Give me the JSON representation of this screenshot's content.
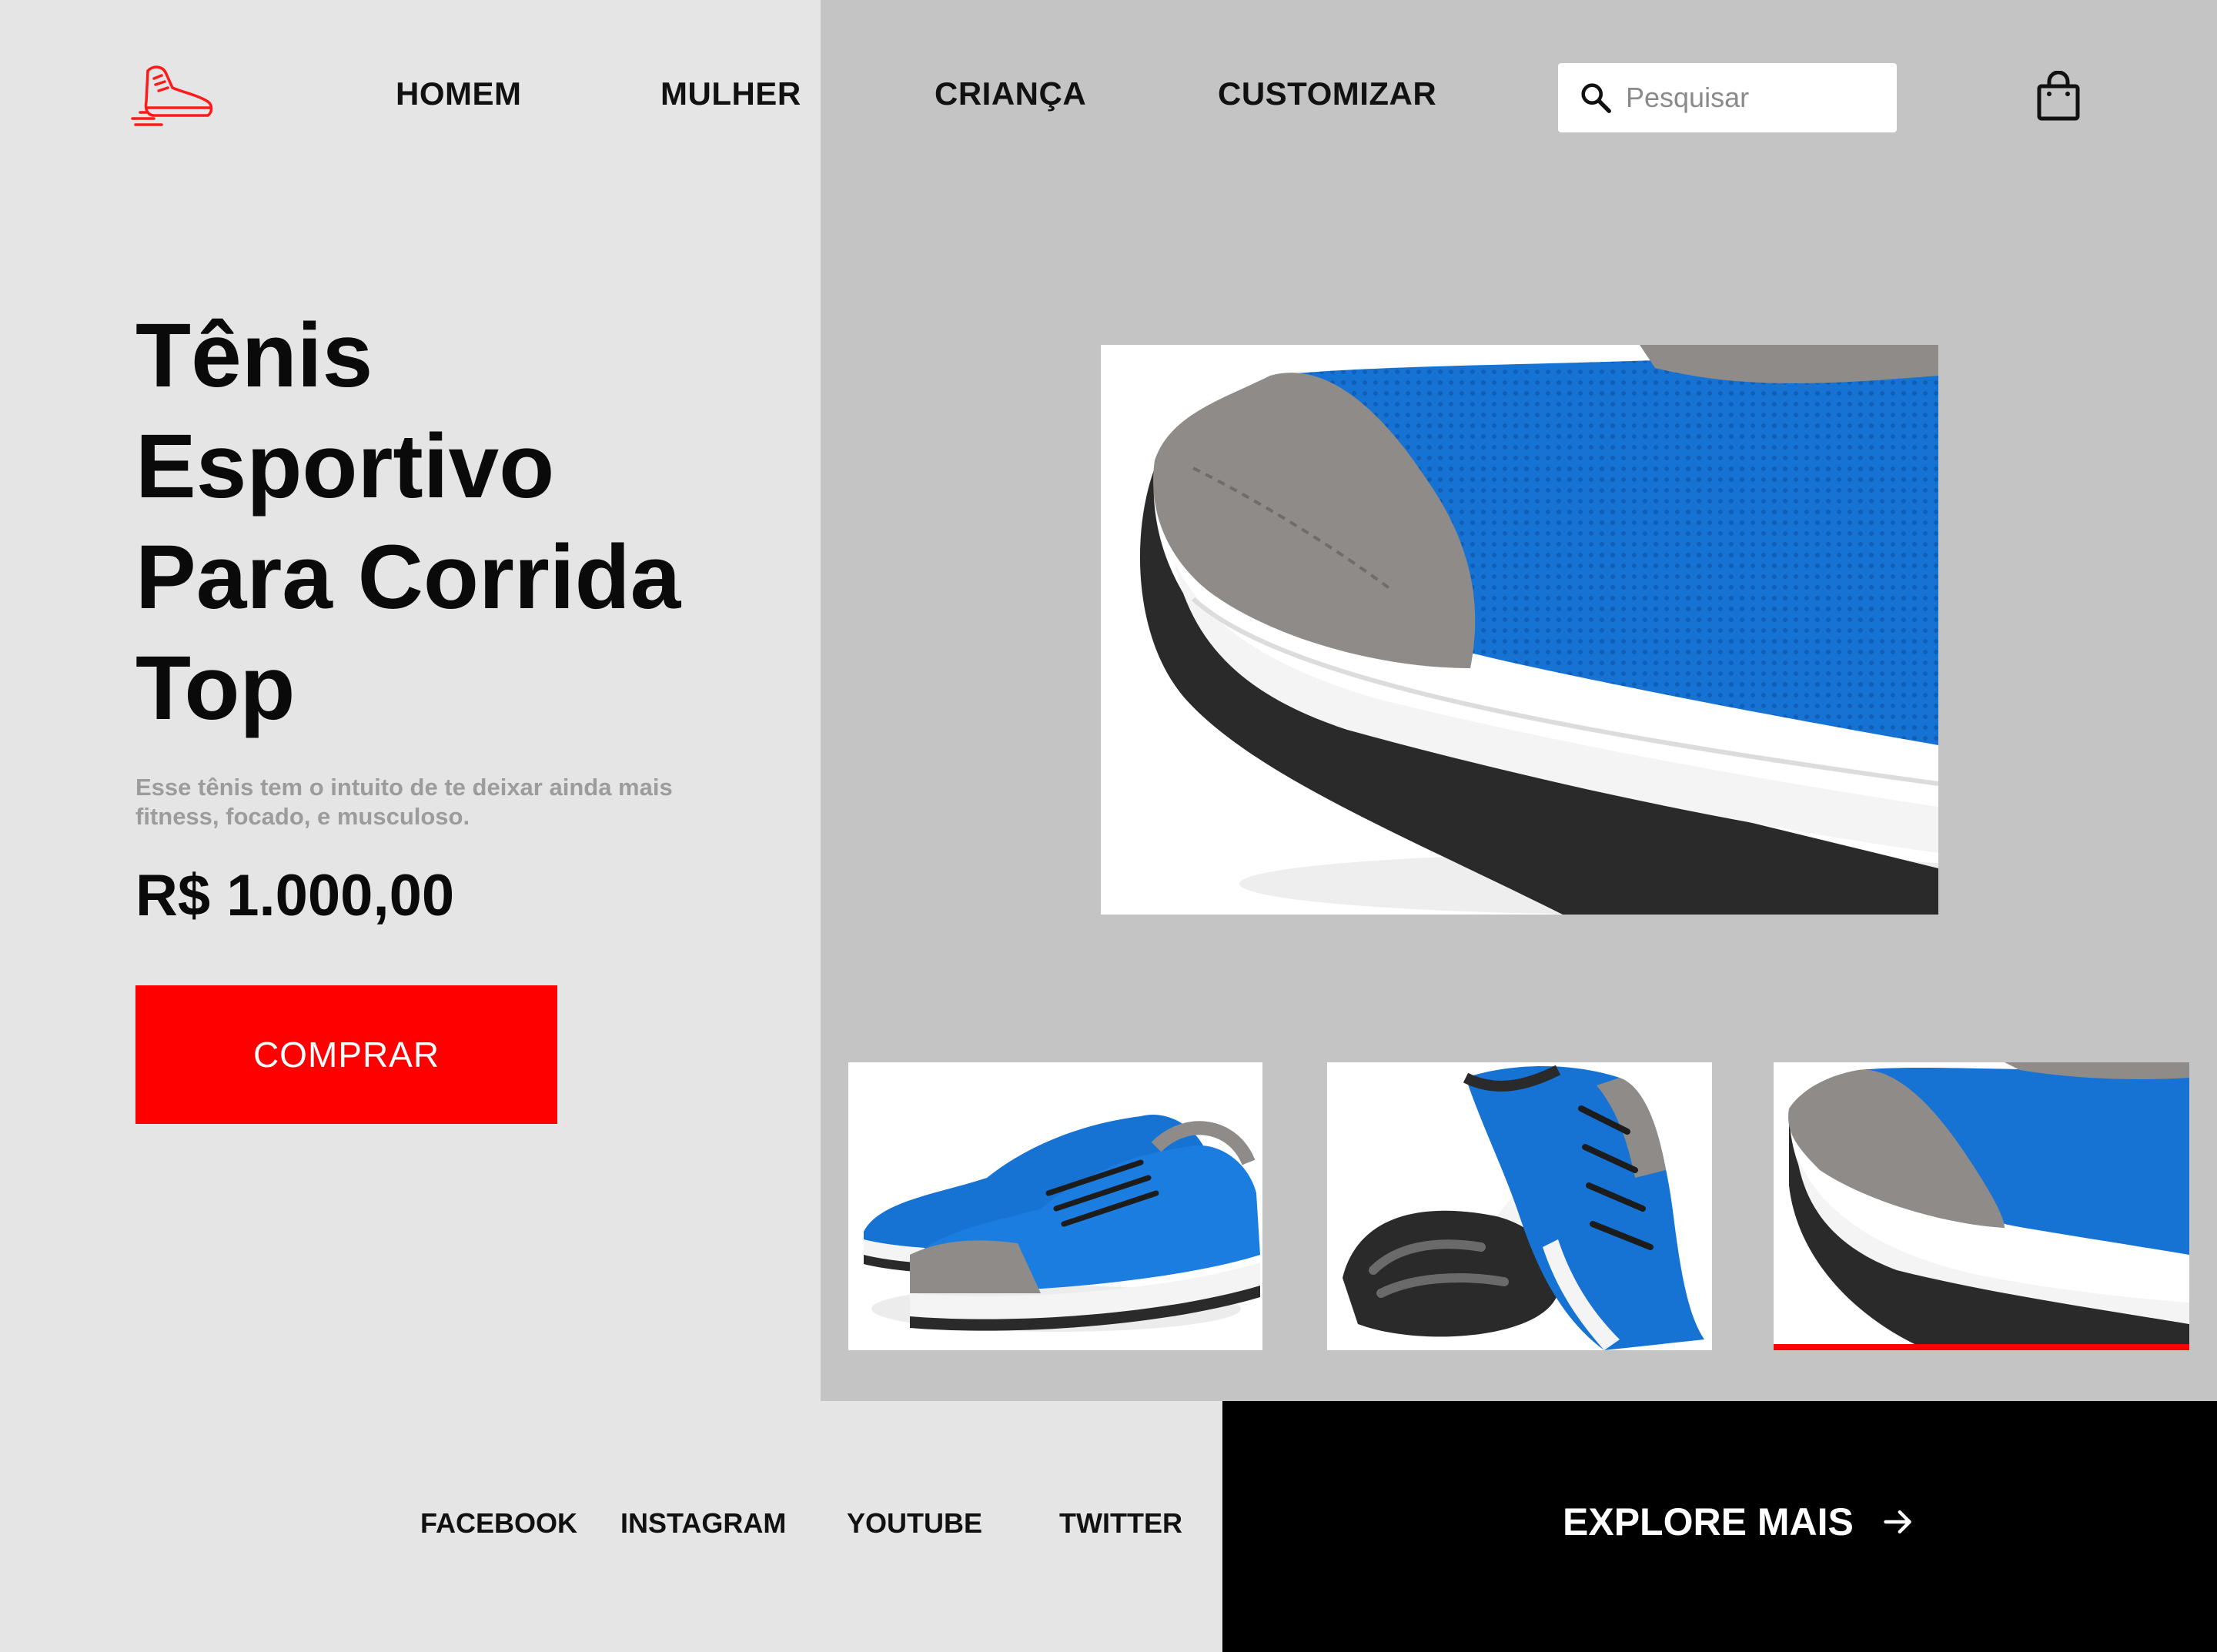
{
  "header": {
    "logo_icon": "running-shoe-icon",
    "nav": [
      "HOMEM",
      "MULHER",
      "CRIANÇA",
      "CUSTOMIZAR"
    ],
    "search": {
      "placeholder": "Pesquisar",
      "icon": "search-icon"
    },
    "cart_icon": "shopping-bag-icon"
  },
  "hero": {
    "title": "Tênis Esportivo Para Corrida Top",
    "description": "Esse tênis tem o intuito de te deixar ainda mais fitness, focado, e musculoso.",
    "price": "R$ 1.000,00",
    "buy_label": "COMPRAR"
  },
  "gallery": {
    "selected_thumbnail": 3
  },
  "footer": {
    "social": [
      "FACEBOOK",
      "INSTAGRAM",
      "YOUTUBE",
      "TWITTER"
    ],
    "explore_label": "EXPLORE MAIS",
    "explore_icon": "arrow-right-icon"
  },
  "colors": {
    "accent": "#ff0000",
    "left_background": "#e5e5e5",
    "right_panel": "#c4c4c4",
    "footer_panel": "#000000",
    "shoe_blue": "#1673d4"
  }
}
